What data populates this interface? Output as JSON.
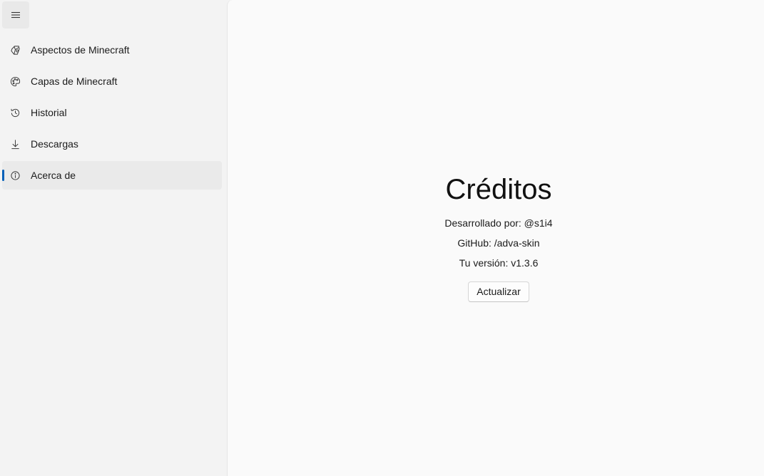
{
  "sidebar": {
    "menu_icon": "hamburger-menu-icon",
    "items": [
      {
        "label": "Aspectos de Minecraft",
        "icon": "skin-icon",
        "active": false
      },
      {
        "label": "Capas de Minecraft",
        "icon": "palette-icon",
        "active": false
      },
      {
        "label": "Historial",
        "icon": "history-icon",
        "active": false
      },
      {
        "label": "Descargas",
        "icon": "download-icon",
        "active": false
      },
      {
        "label": "Acerca de",
        "icon": "info-icon",
        "active": true
      }
    ]
  },
  "credits": {
    "title": "Créditos",
    "developer": "Desarrollado por: @s1i4",
    "github": "GitHub: /adva-skin",
    "version": "Tu versión: v1.3.6",
    "update_button": "Actualizar"
  },
  "colors": {
    "accent": "#005fb8",
    "sidebar_bg": "#f3f3f3",
    "content_bg": "#fafafa"
  }
}
